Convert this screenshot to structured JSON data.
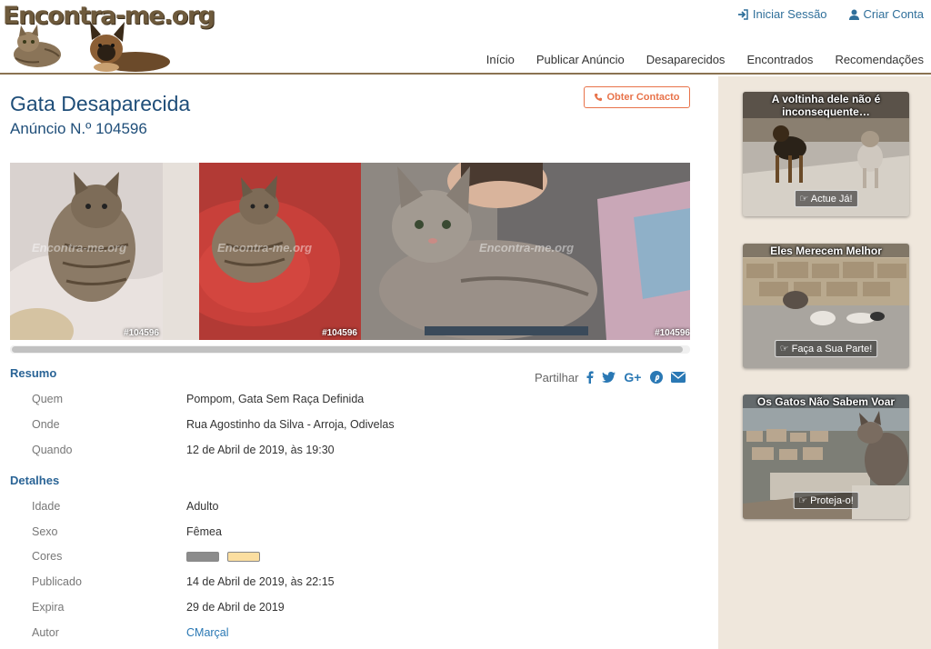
{
  "site": {
    "logo_text": "Encontra-me.org"
  },
  "top_links": {
    "login": "Iniciar Sessão",
    "signup": "Criar Conta"
  },
  "nav": [
    "Início",
    "Publicar Anúncio",
    "Desaparecidos",
    "Encontrados",
    "Recomendações"
  ],
  "listing": {
    "title": "Gata Desaparecida",
    "subtitle": "Anúncio N.º 104596",
    "contact_button": "Obter Contacto",
    "watermark": "Encontra-me.org",
    "photo_tag": "#104596"
  },
  "summary": {
    "heading": "Resumo",
    "share_label": "Partilhar",
    "rows": [
      {
        "key": "Quem",
        "value": "Pompom, Gata Sem Raça Definida"
      },
      {
        "key": "Onde",
        "value": "Rua Agostinho da Silva - Arroja, Odivelas"
      },
      {
        "key": "Quando",
        "value": "12 de Abril de 2019, às 19:30"
      }
    ]
  },
  "details": {
    "heading": "Detalhes",
    "rows": [
      {
        "key": "Idade",
        "value": "Adulto"
      },
      {
        "key": "Sexo",
        "value": "Fêmea"
      },
      {
        "key": "Cores",
        "value": ""
      },
      {
        "key": "Publicado",
        "value": "14 de Abril de 2019, às 22:15"
      },
      {
        "key": "Expira",
        "value": "29 de Abril de 2019"
      },
      {
        "key": "Autor",
        "value": "CMarçal"
      }
    ],
    "colors": [
      "#8c8c8c",
      "#fbdea0"
    ]
  },
  "sidebar": {
    "cards": [
      {
        "caption": "A voltinha dele não é inconsequente…",
        "cta": "Actue Já!"
      },
      {
        "caption": "Eles Merecem Melhor",
        "cta": "Faça a Sua Parte!"
      },
      {
        "caption": "Os Gatos Não Sabem Voar",
        "cta": "Proteja-o!"
      }
    ]
  }
}
